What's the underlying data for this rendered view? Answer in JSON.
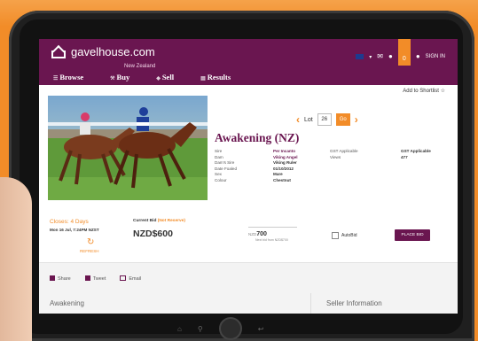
{
  "site": {
    "logo": "gavelhouse.com",
    "logo_sub": "New Zealand"
  },
  "header_tools": {
    "signin": "SIGN IN",
    "notif": "0"
  },
  "nav": {
    "browse": "Browse",
    "buy": "Buy",
    "sell": "Sell",
    "results": "Results"
  },
  "shortlist": "Add to Shortlist",
  "lot": {
    "label": "Lot",
    "number": "26",
    "go": "Go"
  },
  "listing": {
    "title": "Awakening (NZ)",
    "details_left": [
      {
        "k": "Sire",
        "v": "Per Incanto"
      },
      {
        "k": "Dam",
        "v": "Viking Angel"
      },
      {
        "k": "Dam's Sire",
        "v": "Viking Ruler"
      },
      {
        "k": "Date Foaled",
        "v": "01/10/2012"
      },
      {
        "k": "Sex",
        "v": "Mare"
      },
      {
        "k": "Colour",
        "v": "Chestnut"
      }
    ],
    "details_right": [
      {
        "k": "GST Applicable",
        "v": "GST Applicable"
      },
      {
        "k": "Views",
        "v": "477"
      }
    ]
  },
  "bid": {
    "closes": "Closes: 4 Days",
    "closes_date": "Mon 16 Jul, 7:24PM NZST",
    "refresh": "REFRESH",
    "current_label": "Current Bid",
    "reserve_note": "(Not Reserve)",
    "current_value": "NZD$600",
    "input_prefix": "NZD",
    "input_value": "700",
    "input_note": "Next bid from NZD$700",
    "autobid": "AutoBid",
    "place_bid": "PLACE BID"
  },
  "share": {
    "share": "Share",
    "tweet": "Tweet",
    "email": "Email"
  },
  "sections": {
    "left": "Awakening",
    "right": "Seller Information"
  },
  "colors": {
    "brand": "#6a1650",
    "accent": "#f28c28"
  }
}
